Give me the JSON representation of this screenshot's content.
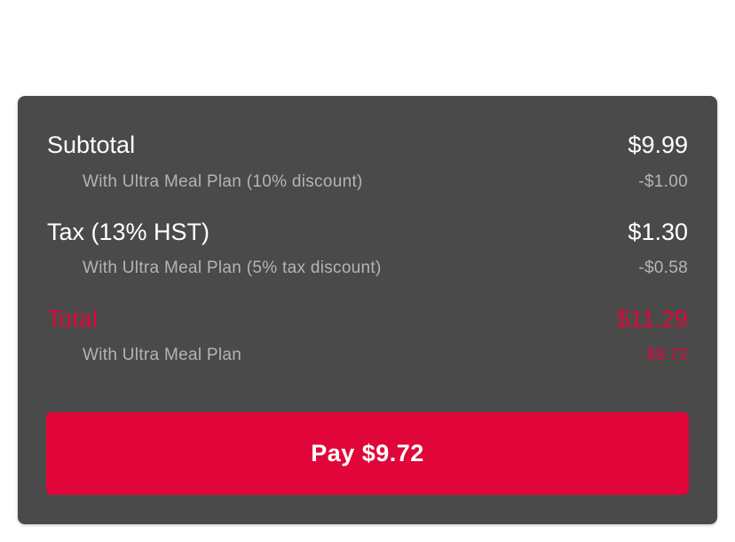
{
  "summary": {
    "subtotal": {
      "label": "Subtotal",
      "value": "$9.99",
      "discount_label": "With Ultra Meal Plan (10% discount)",
      "discount_value": "-$1.00"
    },
    "tax": {
      "label": "Tax (13% HST)",
      "value": "$1.30",
      "discount_label": "With Ultra Meal Plan (5% tax discount)",
      "discount_value": "-$0.58"
    },
    "total": {
      "label": "Total",
      "value": "$11.29",
      "plan_label": "With Ultra Meal Plan",
      "plan_value": "$9.72"
    }
  },
  "pay_button": {
    "label": "Pay $9.72"
  },
  "colors": {
    "card_background": "#4a4a4a",
    "accent": "#e0063a",
    "primary_text": "#ffffff",
    "secondary_text": "#b4b4b4"
  }
}
